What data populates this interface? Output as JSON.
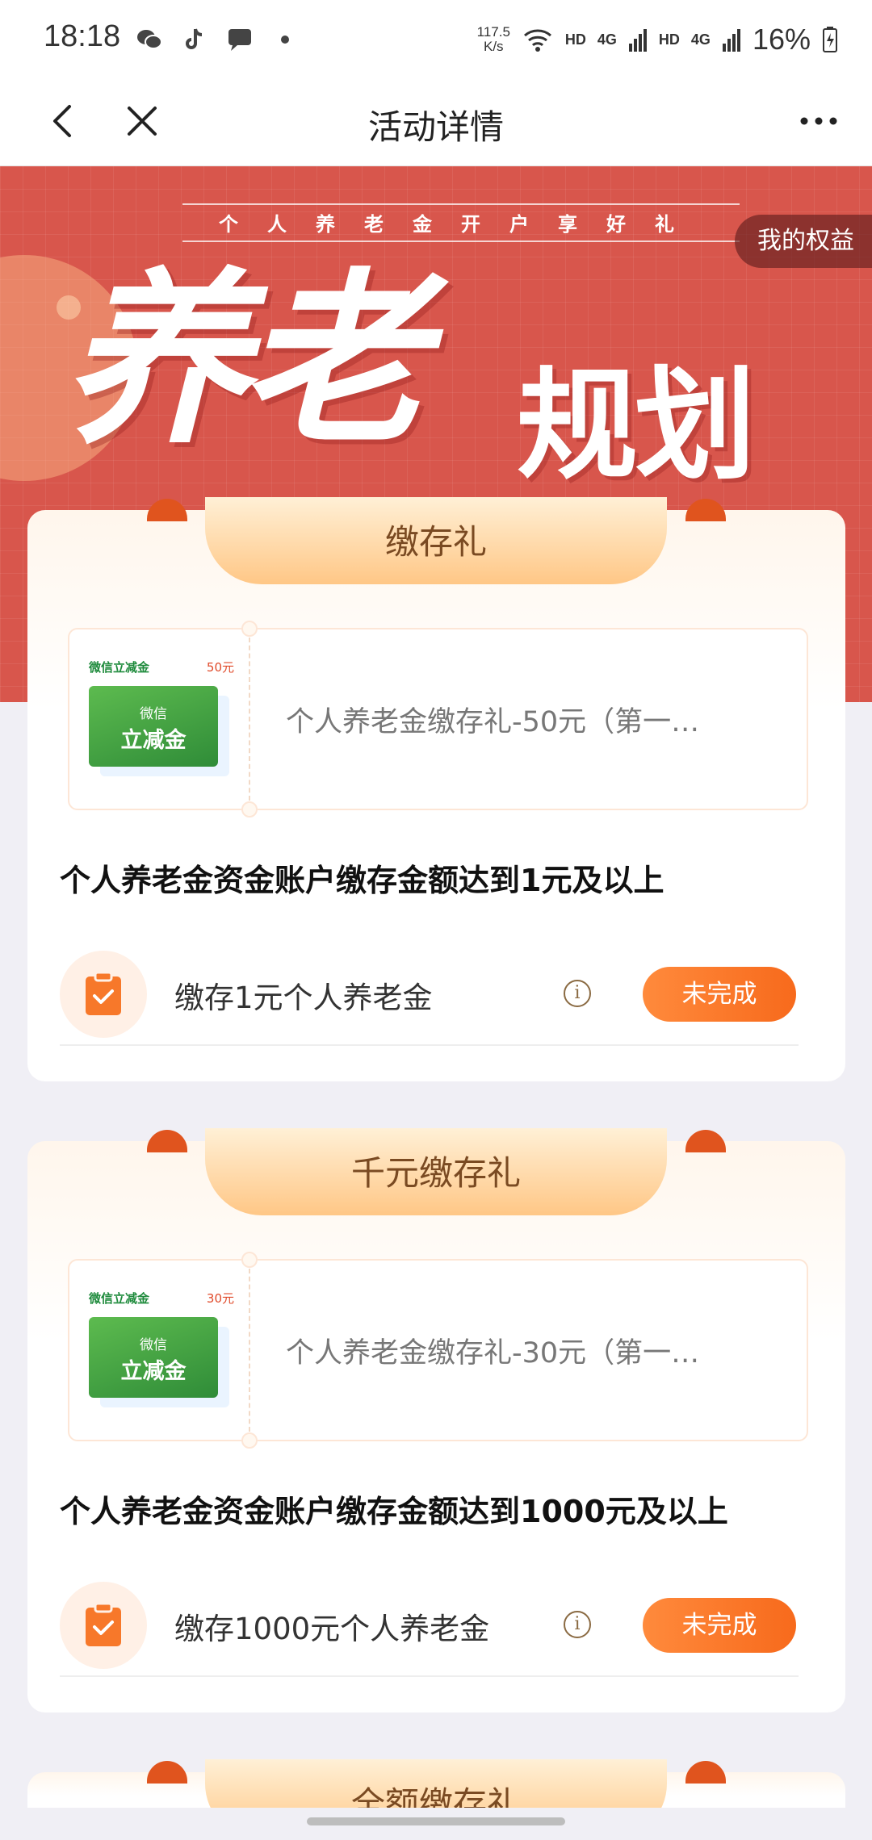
{
  "status_bar": {
    "time": "18:18",
    "speed_top": "117.5",
    "speed_bottom": "K/s",
    "hd1": "HD",
    "net1": "4G",
    "hd2": "HD",
    "net2": "4G",
    "battery": "16%"
  },
  "nav": {
    "title": "活动详情"
  },
  "banner": {
    "subtitle": "个人养老金开户享好礼",
    "big_title_1": "养老",
    "big_title_2": "规划",
    "my_rights": "我的权益"
  },
  "cards": [
    {
      "tab": "缴存礼",
      "coupon": {
        "brand": "微信立减金",
        "amount": "50元",
        "thumb_line1": "微信",
        "thumb_line2": "立减金",
        "title": "个人养老金缴存礼-50元（第一…"
      },
      "requirement": "个人养老金资金账户缴存金额达到1元及以上",
      "task": {
        "label": "缴存1元个人养老金",
        "info": "i",
        "button": "未完成"
      }
    },
    {
      "tab": "千元缴存礼",
      "coupon": {
        "brand": "微信立减金",
        "amount": "30元",
        "thumb_line1": "微信",
        "thumb_line2": "立减金",
        "title": "个人养老金缴存礼-30元（第一…"
      },
      "requirement": "个人养老金资金账户缴存金额达到1000元及以上",
      "task": {
        "label": "缴存1000元个人养老金",
        "info": "i",
        "button": "未完成"
      }
    },
    {
      "tab": "全额缴存礼"
    }
  ],
  "colors": {
    "banner_red": "#d8564c",
    "accent_orange": "#f76a1c",
    "tab_gold": "#ffc786",
    "text_brown": "#7a4a22"
  }
}
